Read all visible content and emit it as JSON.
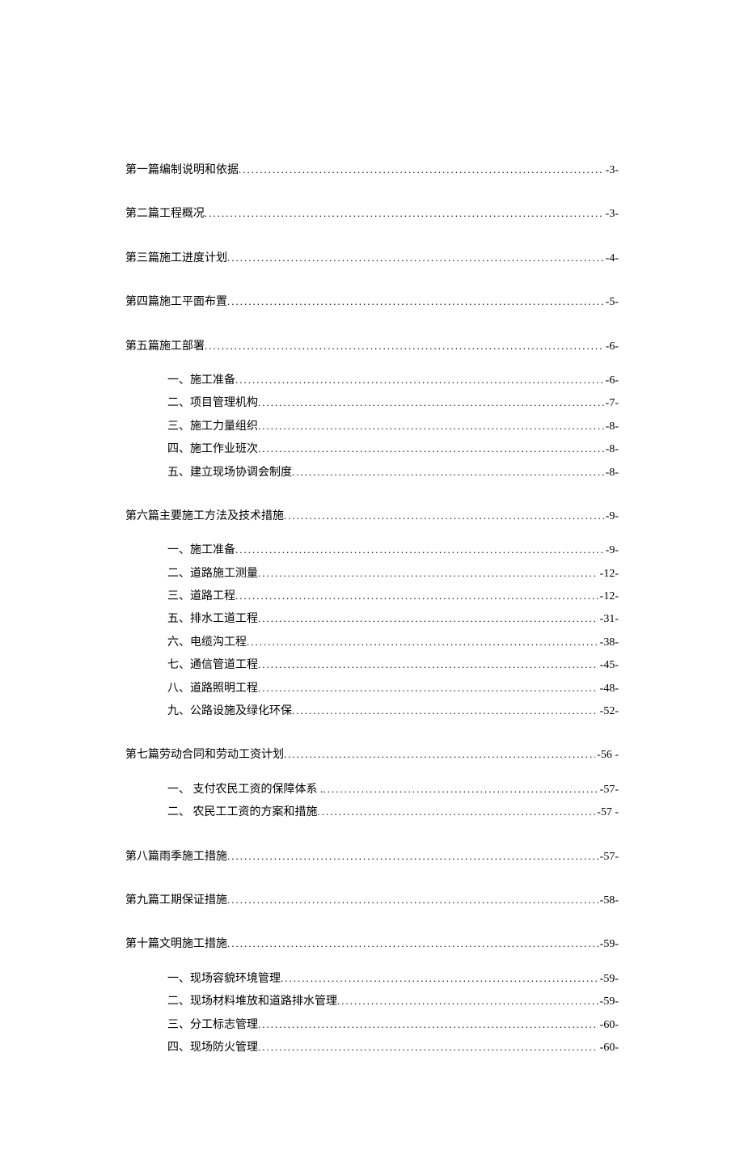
{
  "toc": {
    "chapters": [
      {
        "title": "第一篇编制说明和依据",
        "page": "-3-",
        "subs": []
      },
      {
        "title": "第二篇工程概况",
        "page": "-3-",
        "subs": []
      },
      {
        "title": "第三篇施工进度计划",
        "page": "-4-",
        "subs": []
      },
      {
        "title": "第四篇施工平面布置",
        "page": "-5-",
        "subs": []
      },
      {
        "title": "第五篇施工部署",
        "page": "-6-",
        "subs": [
          {
            "title": "一、施工准备",
            "page": "-6-"
          },
          {
            "title": "二、项目管理机构",
            "page": "-7-"
          },
          {
            "title": "三、施工力量组织",
            "page": "-8-"
          },
          {
            "title": "四、施工作业班次",
            "page": "-8-"
          },
          {
            "title": "五、建立现场协调会制度",
            "page": "-8-"
          }
        ]
      },
      {
        "title": "第六篇主要施工方法及技术措施",
        "page": "-9-",
        "subs": [
          {
            "title": "一、施工准备",
            "page": "-9-"
          },
          {
            "title": "二、道路施工测量",
            "page": "-12-"
          },
          {
            "title": "三、道路工程",
            "page": "-12-"
          },
          {
            "title": "五、排水工道工程",
            "page": "-31-"
          },
          {
            "title": "六、电缆沟工程",
            "page": "-38-"
          },
          {
            "title": "七、通信管道工程",
            "page": "-45-"
          },
          {
            "title": "八、道路照明工程",
            "page": "-48-"
          },
          {
            "title": "九、公路设施及绿化环保",
            "page": "-52-"
          }
        ]
      },
      {
        "title": "第七篇劳动合同和劳动工资计划 ",
        "page": "-56  -",
        "subs": [
          {
            "title": "一、  支付农民工资的保障体系 .",
            "page": "-57-"
          },
          {
            "title": "二、  农民工工资的方案和措施 ",
            "page": "-57  -"
          }
        ]
      },
      {
        "title": "第八篇雨季施工措施",
        "page": "-57-",
        "subs": []
      },
      {
        "title": "第九篇工期保证措施",
        "page": "-58-",
        "subs": []
      },
      {
        "title": "第十篇文明施工措施",
        "page": "-59-",
        "subs": [
          {
            "title": "一、现场容貌环境管理",
            "page": "-59-"
          },
          {
            "title": "二、现场材料堆放和道路排水管理",
            "page": "-59-"
          },
          {
            "title": "三、分工标志管理",
            "page": "-60-"
          },
          {
            "title": "四、现场防火管理",
            "page": "-60-"
          }
        ]
      }
    ]
  }
}
